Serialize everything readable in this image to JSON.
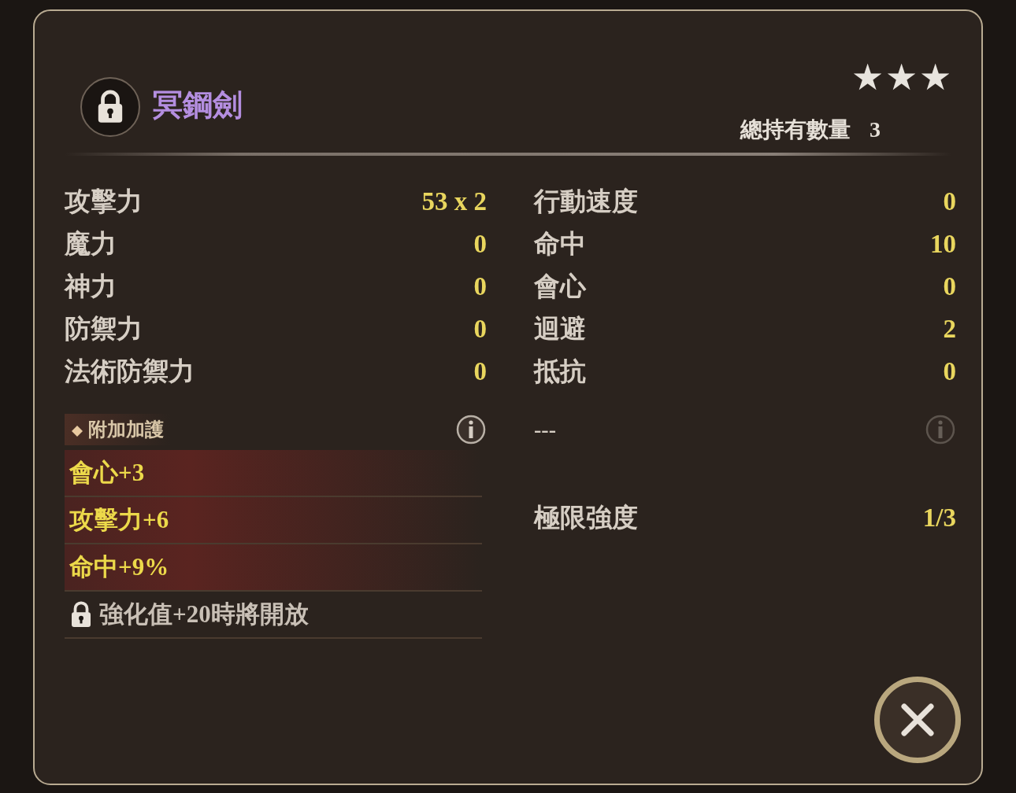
{
  "item": {
    "name": "冥鋼劍",
    "locked": true,
    "stars": 3,
    "owned_label": "總持有數量",
    "owned_count": "3"
  },
  "stats_left": [
    {
      "label": "攻擊力",
      "value": "53 x 2"
    },
    {
      "label": "魔力",
      "value": "0"
    },
    {
      "label": "神力",
      "value": "0"
    },
    {
      "label": "防禦力",
      "value": "0"
    },
    {
      "label": "法術防禦力",
      "value": "0"
    }
  ],
  "stats_right": [
    {
      "label": "行動速度",
      "value": "0"
    },
    {
      "label": "命中",
      "value": "10"
    },
    {
      "label": "會心",
      "value": "0"
    },
    {
      "label": "迴避",
      "value": "2"
    },
    {
      "label": "抵抗",
      "value": "0"
    }
  ],
  "bonus": {
    "title": "附加加護",
    "info_enabled": true,
    "items": [
      {
        "kind": "bonus",
        "text": "會心+3"
      },
      {
        "kind": "bonus",
        "text": "攻擊力+6"
      },
      {
        "kind": "bonus",
        "text": "命中+9%"
      },
      {
        "kind": "locked",
        "text": "強化值+20時將開放"
      }
    ]
  },
  "bonus_right": {
    "title": "---",
    "info_enabled": false
  },
  "limit": {
    "label": "極限強度",
    "value": "1/3"
  }
}
